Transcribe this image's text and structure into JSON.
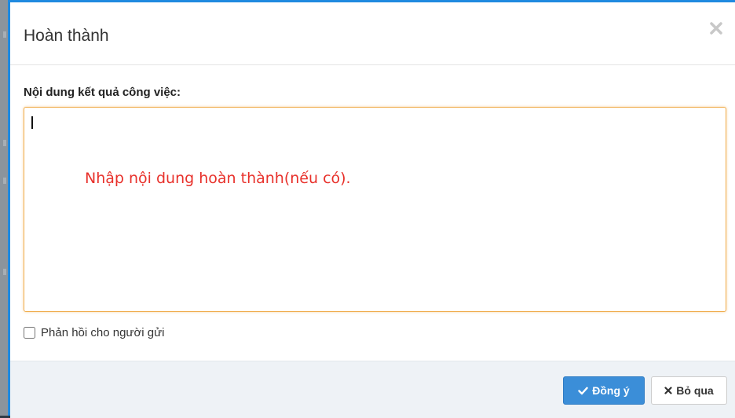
{
  "modal": {
    "title": "Hoàn thành"
  },
  "form": {
    "content_label": "Nội dung kết quả công việc:",
    "textarea_value": "",
    "hint_annotation": "Nhập nội dung hoàn thành(nếu có).",
    "feedback_label": "Phản hồi cho người gửi",
    "feedback_checked": false
  },
  "footer": {
    "agree_label": "Đồng ý",
    "cancel_label": "Bỏ qua"
  },
  "icons": {
    "close": "close-icon",
    "agree": "check-icon",
    "cancel": "times-icon"
  },
  "colors": {
    "accent": "#1f8ae0",
    "primary_button": "#3b8ed8",
    "focus_border": "#f0ad4e",
    "hint_text": "#e8312b"
  }
}
